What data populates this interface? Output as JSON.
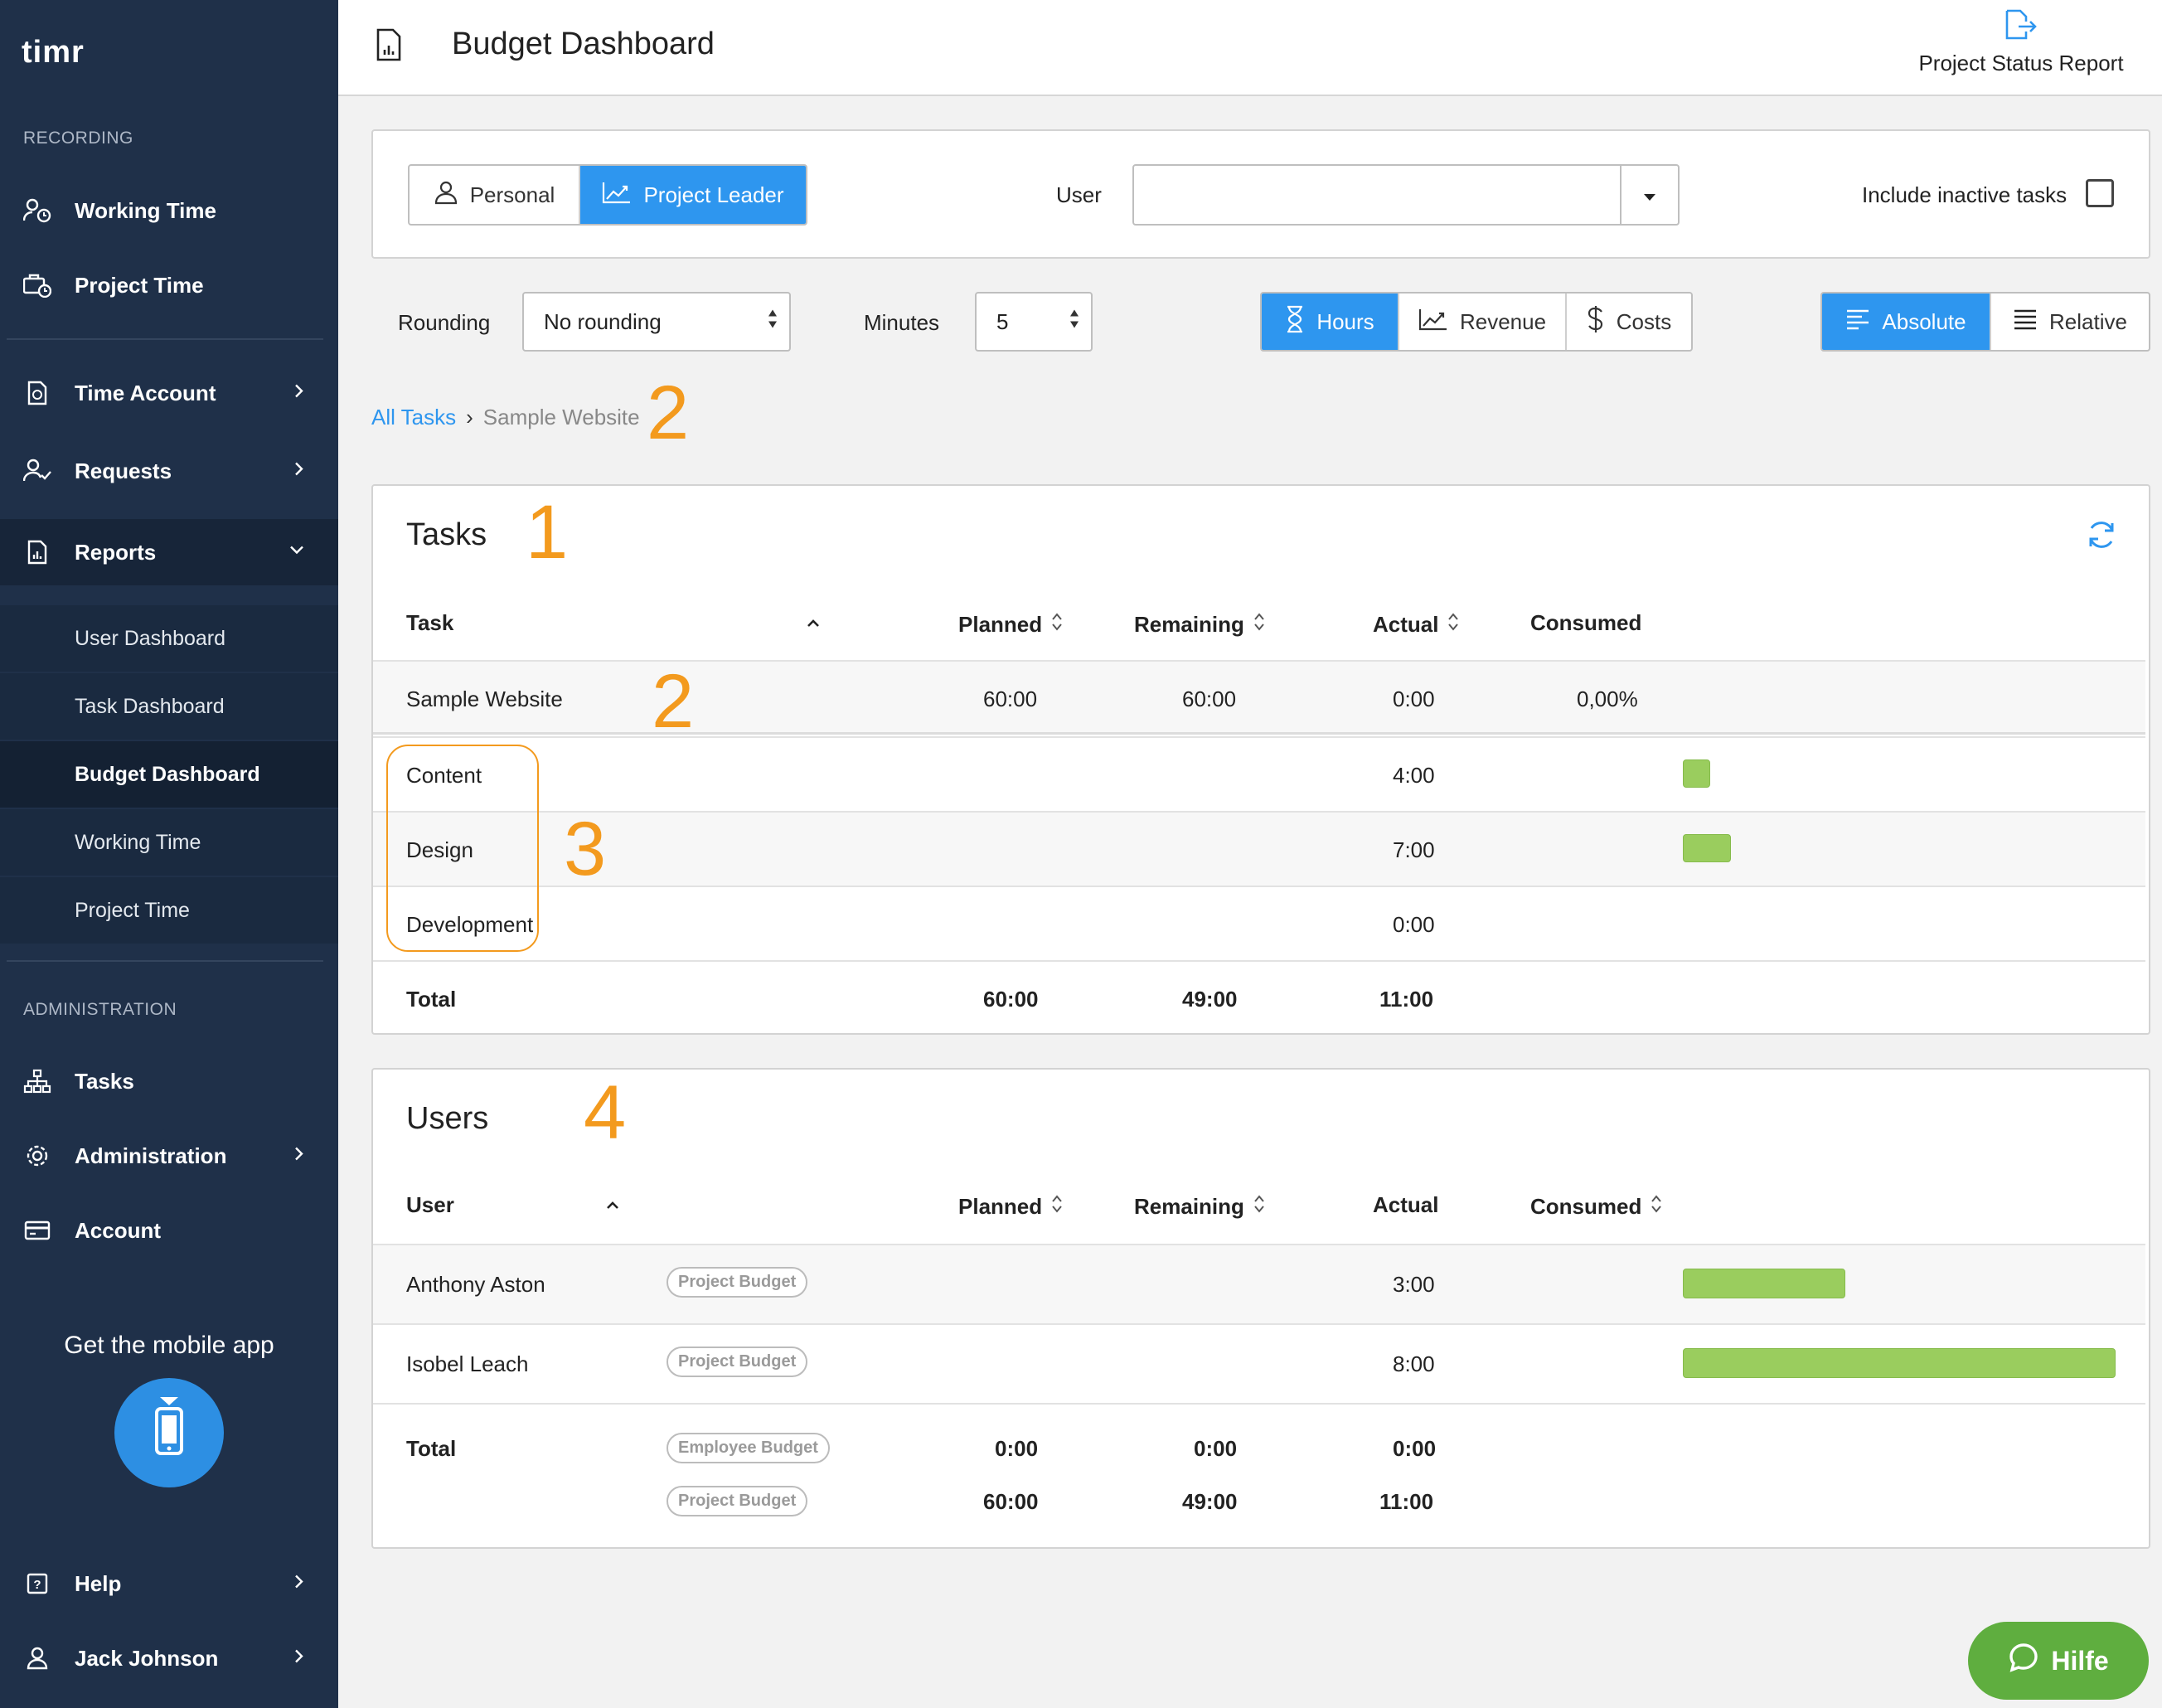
{
  "app": {
    "logo_text": "timr"
  },
  "sidebar": {
    "section_recording": "RECORDING",
    "working_time": "Working Time",
    "project_time": "Project Time",
    "time_account": "Time Account",
    "requests": "Requests",
    "reports": "Reports",
    "sub": {
      "user_dashboard": "User Dashboard",
      "task_dashboard": "Task Dashboard",
      "budget_dashboard": "Budget Dashboard",
      "working_time": "Working Time",
      "project_time": "Project Time"
    },
    "section_admin": "ADMINISTRATION",
    "tasks": "Tasks",
    "administration": "Administration",
    "account": "Account",
    "mobile_app": "Get the mobile app",
    "help": "Help",
    "user_name": "Jack Johnson"
  },
  "header": {
    "title": "Budget Dashboard",
    "report_button": "Project Status Report"
  },
  "filters": {
    "personal": "Personal",
    "project_leader": "Project Leader",
    "user_label": "User",
    "user_value": "",
    "include_inactive": "Include inactive tasks",
    "rounding_label": "Rounding",
    "rounding_value": "No rounding",
    "minutes_label": "Minutes",
    "minutes_value": "5",
    "hours": "Hours",
    "revenue": "Revenue",
    "costs": "Costs",
    "absolute": "Absolute",
    "relative": "Relative"
  },
  "breadcrumb": {
    "root": "All Tasks",
    "sep": "›",
    "current": "Sample Website"
  },
  "annotations": {
    "a1": "1",
    "a2": "2",
    "a3": "3",
    "a4": "4"
  },
  "tasks_table": {
    "title": "Tasks",
    "headers": {
      "task": "Task",
      "planned": "Planned",
      "remaining": "Remaining",
      "actual": "Actual",
      "consumed": "Consumed"
    },
    "parent": {
      "name": "Sample Website",
      "planned": "60:00",
      "remaining": "60:00",
      "actual": "0:00",
      "consumed": "0,00%"
    },
    "rows": [
      {
        "name": "Content",
        "actual": "4:00",
        "bar": 0.064
      },
      {
        "name": "Design",
        "actual": "7:00",
        "bar": 0.112
      },
      {
        "name": "Development",
        "actual": "0:00",
        "bar": 0
      }
    ],
    "total": {
      "label": "Total",
      "planned": "60:00",
      "remaining": "49:00",
      "actual": "11:00"
    }
  },
  "users_table": {
    "title": "Users",
    "headers": {
      "user": "User",
      "planned": "Planned",
      "remaining": "Remaining",
      "actual": "Actual",
      "consumed": "Consumed"
    },
    "rows": [
      {
        "name": "Anthony Aston",
        "badge": "Project Budget",
        "actual": "3:00",
        "bar": 0.375
      },
      {
        "name": "Isobel Leach",
        "badge": "Project Budget",
        "actual": "8:00",
        "bar": 1.0
      }
    ],
    "total": {
      "label": "Total",
      "employee_badge": "Employee Budget",
      "employee": {
        "planned": "0:00",
        "remaining": "0:00",
        "actual": "0:00"
      },
      "project_badge": "Project Budget",
      "project": {
        "planned": "60:00",
        "remaining": "49:00",
        "actual": "11:00"
      }
    }
  },
  "chat": {
    "label": "Hilfe"
  },
  "colors": {
    "accent": "#2e96ef",
    "sidebar": "#1f3049",
    "bar": "#9acd5e",
    "annotation": "#f39a1e",
    "chat": "#5fae3f"
  }
}
